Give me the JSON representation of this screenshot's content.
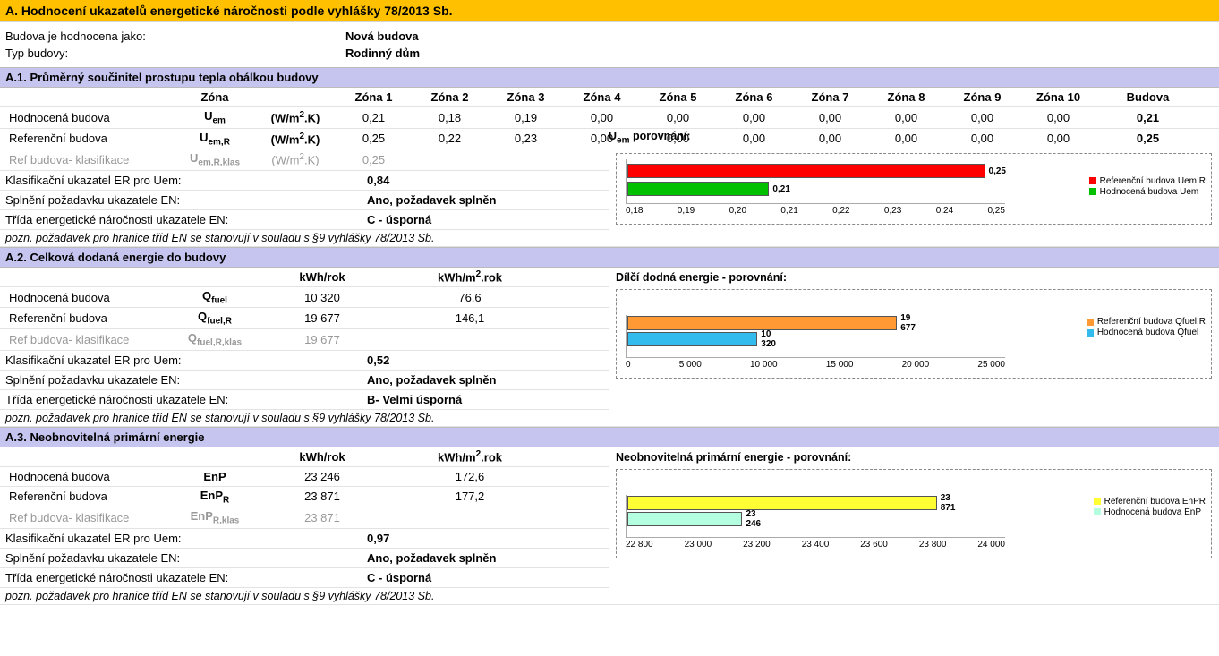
{
  "header": {
    "main": "A. Hodnocení ukazatelů energetické náročnosti podle vyhlášky 78/2013 Sb."
  },
  "info": {
    "eval_label": "Budova je hodnocena jako:",
    "eval_value": "Nová budova",
    "type_label": "Typ budovy:",
    "type_value": "Rodinný dům"
  },
  "a1": {
    "title": "A.1. Průměrný součinitel prostupu tepla obálkou budovy",
    "zone_label": "Zóna",
    "budova": "Budova",
    "zones": [
      "Zóna 1",
      "Zóna 2",
      "Zóna 3",
      "Zóna 4",
      "Zóna 5",
      "Zóna 6",
      "Zóna 7",
      "Zóna 8",
      "Zóna 9",
      "Zóna 10"
    ],
    "rows": {
      "hod": {
        "label": "Hodnocená budova",
        "sym": "U_em",
        "unit": "(W/m².K)",
        "vals": [
          "0,21",
          "0,18",
          "0,19",
          "0,00",
          "0,00",
          "0,00",
          "0,00",
          "0,00",
          "0,00",
          "0,00"
        ],
        "total": "0,21"
      },
      "ref": {
        "label": "Referenční budova",
        "sym": "U_em,R",
        "unit": "(W/m².K)",
        "vals": [
          "0,25",
          "0,22",
          "0,23",
          "0,00",
          "0,00",
          "0,00",
          "0,00",
          "0,00",
          "0,00",
          "0,00"
        ],
        "total": "0,25"
      },
      "klas": {
        "label": "Ref budova- klasifikace",
        "sym": "U_em,R,klas",
        "unit": "(W/m².K)",
        "vals": [
          "0,25",
          "",
          "",
          "",
          "",
          "",
          "",
          "",
          "",
          ""
        ],
        "total": ""
      }
    },
    "cmp_label": "U_em porovnání:",
    "er": {
      "label": "Klasifikační ukazatel ER pro Uem:",
      "val": "0,84"
    },
    "splneni": {
      "label": "Splnění požadavku ukazatele EN:",
      "val": "Ano, požadavek splněn"
    },
    "trida": {
      "label": "Třída energetické náročnosti ukazatele EN:",
      "val": "C - úsporná"
    },
    "note": "pozn. požadavek pro hranice tříd EN se stanovují v souladu s §9 vyhlášky 78/2013 Sb.",
    "chart": {
      "legend": [
        {
          "name": "Referenční budova Uem,R",
          "color": "#ff0000"
        },
        {
          "name": "Hodnocená budova Uem",
          "color": "#00c000"
        }
      ],
      "axis": [
        "0,18",
        "0,19",
        "0,20",
        "0,21",
        "0,22",
        "0,23",
        "0,24",
        "0,25"
      ],
      "bars": [
        {
          "color": "#ff0000",
          "frac": 1.0,
          "label": "0,25"
        },
        {
          "color": "#00c000",
          "frac": 0.43,
          "label": "0,21"
        }
      ]
    }
  },
  "a2": {
    "title": "A.2. Celková dodaná energie do budovy",
    "cols": [
      "",
      "",
      "kWh/rok",
      "kWh/m².rok"
    ],
    "rows": {
      "hod": {
        "label": "Hodnocená budova",
        "sym": "Q_fuel",
        "v1": "10 320",
        "v2": "76,6"
      },
      "ref": {
        "label": "Referenční budova",
        "sym": "Q_fuel,R",
        "v1": "19 677",
        "v2": "146,1"
      },
      "klas": {
        "label": "Ref budova- klasifikace",
        "sym": "Q_fuel,R,klas",
        "v1": "19 677",
        "v2": ""
      }
    },
    "er": {
      "label": "Klasifikační ukazatel ER pro Uem:",
      "val": "0,52"
    },
    "splneni": {
      "label": "Splnění požadavku ukazatele EN:",
      "val": "Ano, požadavek splněn"
    },
    "trida": {
      "label": "Třída energetické náročnosti ukazatele EN:",
      "val": "B- Velmi úsporná"
    },
    "note": "pozn. požadavek pro hranice tříd EN se stanovují v souladu s §9 vyhlášky 78/2013 Sb.",
    "chart_title": "Dílčí dodná energie - porovnání:",
    "chart": {
      "legend": [
        {
          "name": "Referenční budova Qfuel,R",
          "color": "#ff9933"
        },
        {
          "name": "Hodnocená budova Qfuel",
          "color": "#33bbee"
        }
      ],
      "axis": [
        "0",
        "5 000",
        "10 000",
        "15 000",
        "20 000",
        "25 000"
      ],
      "bars": [
        {
          "color": "#ff9933",
          "frac": 0.787,
          "label": "19 677"
        },
        {
          "color": "#33bbee",
          "frac": 0.413,
          "label": "10 320"
        }
      ]
    }
  },
  "a3": {
    "title": "A.3. Neobnovitelná primární energie",
    "cols": [
      "",
      "",
      "kWh/rok",
      "kWh/m².rok"
    ],
    "rows": {
      "hod": {
        "label": "Hodnocená budova",
        "sym": "EnP",
        "v1": "23 246",
        "v2": "172,6"
      },
      "ref": {
        "label": "Referenční budova",
        "sym": "EnP_R",
        "v1": "23 871",
        "v2": "177,2"
      },
      "klas": {
        "label": "Ref budova- klasifikace",
        "sym": "EnP_R,klas",
        "v1": "23 871",
        "v2": ""
      }
    },
    "er": {
      "label": "Klasifikační ukazatel ER pro Uem:",
      "val": "0,97"
    },
    "splneni": {
      "label": "Splnění požadavku ukazatele EN:",
      "val": "Ano, požadavek splněn"
    },
    "trida": {
      "label": "Třída energetické náročnosti ukazatele EN:",
      "val": "C - úsporná"
    },
    "note": "pozn. požadavek pro hranice tříd EN se stanovují v souladu s §9 vyhlášky 78/2013 Sb.",
    "chart_title": "Neobnovitelná primární energie - porovnání:",
    "chart": {
      "legend": [
        {
          "name": "Referenční budova EnPR",
          "color": "#ffff33"
        },
        {
          "name": "Hodnocená budova EnP",
          "color": "#b3ffe0"
        }
      ],
      "axis": [
        "22 800",
        "23 000",
        "23 200",
        "23 400",
        "23 600",
        "23 800",
        "24 000"
      ],
      "bars": [
        {
          "color": "#ffff33",
          "frac": 0.893,
          "label": "23 871"
        },
        {
          "color": "#b3ffe0",
          "frac": 0.372,
          "label": "23 246"
        }
      ]
    }
  },
  "chart_data": [
    {
      "type": "bar",
      "orientation": "horizontal",
      "title": "U_em porovnání",
      "series": [
        {
          "name": "Referenční budova Uem,R",
          "values": [
            0.25
          ]
        },
        {
          "name": "Hodnocená budova Uem",
          "values": [
            0.21
          ]
        }
      ],
      "xlim": [
        0.18,
        0.25
      ],
      "x_ticks": [
        0.18,
        0.19,
        0.2,
        0.21,
        0.22,
        0.23,
        0.24,
        0.25
      ]
    },
    {
      "type": "bar",
      "orientation": "horizontal",
      "title": "Dílčí dodná energie - porovnání",
      "series": [
        {
          "name": "Referenční budova Qfuel,R",
          "values": [
            19677
          ]
        },
        {
          "name": "Hodnocená budova Qfuel",
          "values": [
            10320
          ]
        }
      ],
      "xlim": [
        0,
        25000
      ],
      "x_ticks": [
        0,
        5000,
        10000,
        15000,
        20000,
        25000
      ]
    },
    {
      "type": "bar",
      "orientation": "horizontal",
      "title": "Neobnovitelná primární energie - porovnání",
      "series": [
        {
          "name": "Referenční budova EnPR",
          "values": [
            23871
          ]
        },
        {
          "name": "Hodnocená budova EnP",
          "values": [
            23246
          ]
        }
      ],
      "xlim": [
        22800,
        24000
      ],
      "x_ticks": [
        22800,
        23000,
        23200,
        23400,
        23600,
        23800,
        24000
      ]
    }
  ]
}
